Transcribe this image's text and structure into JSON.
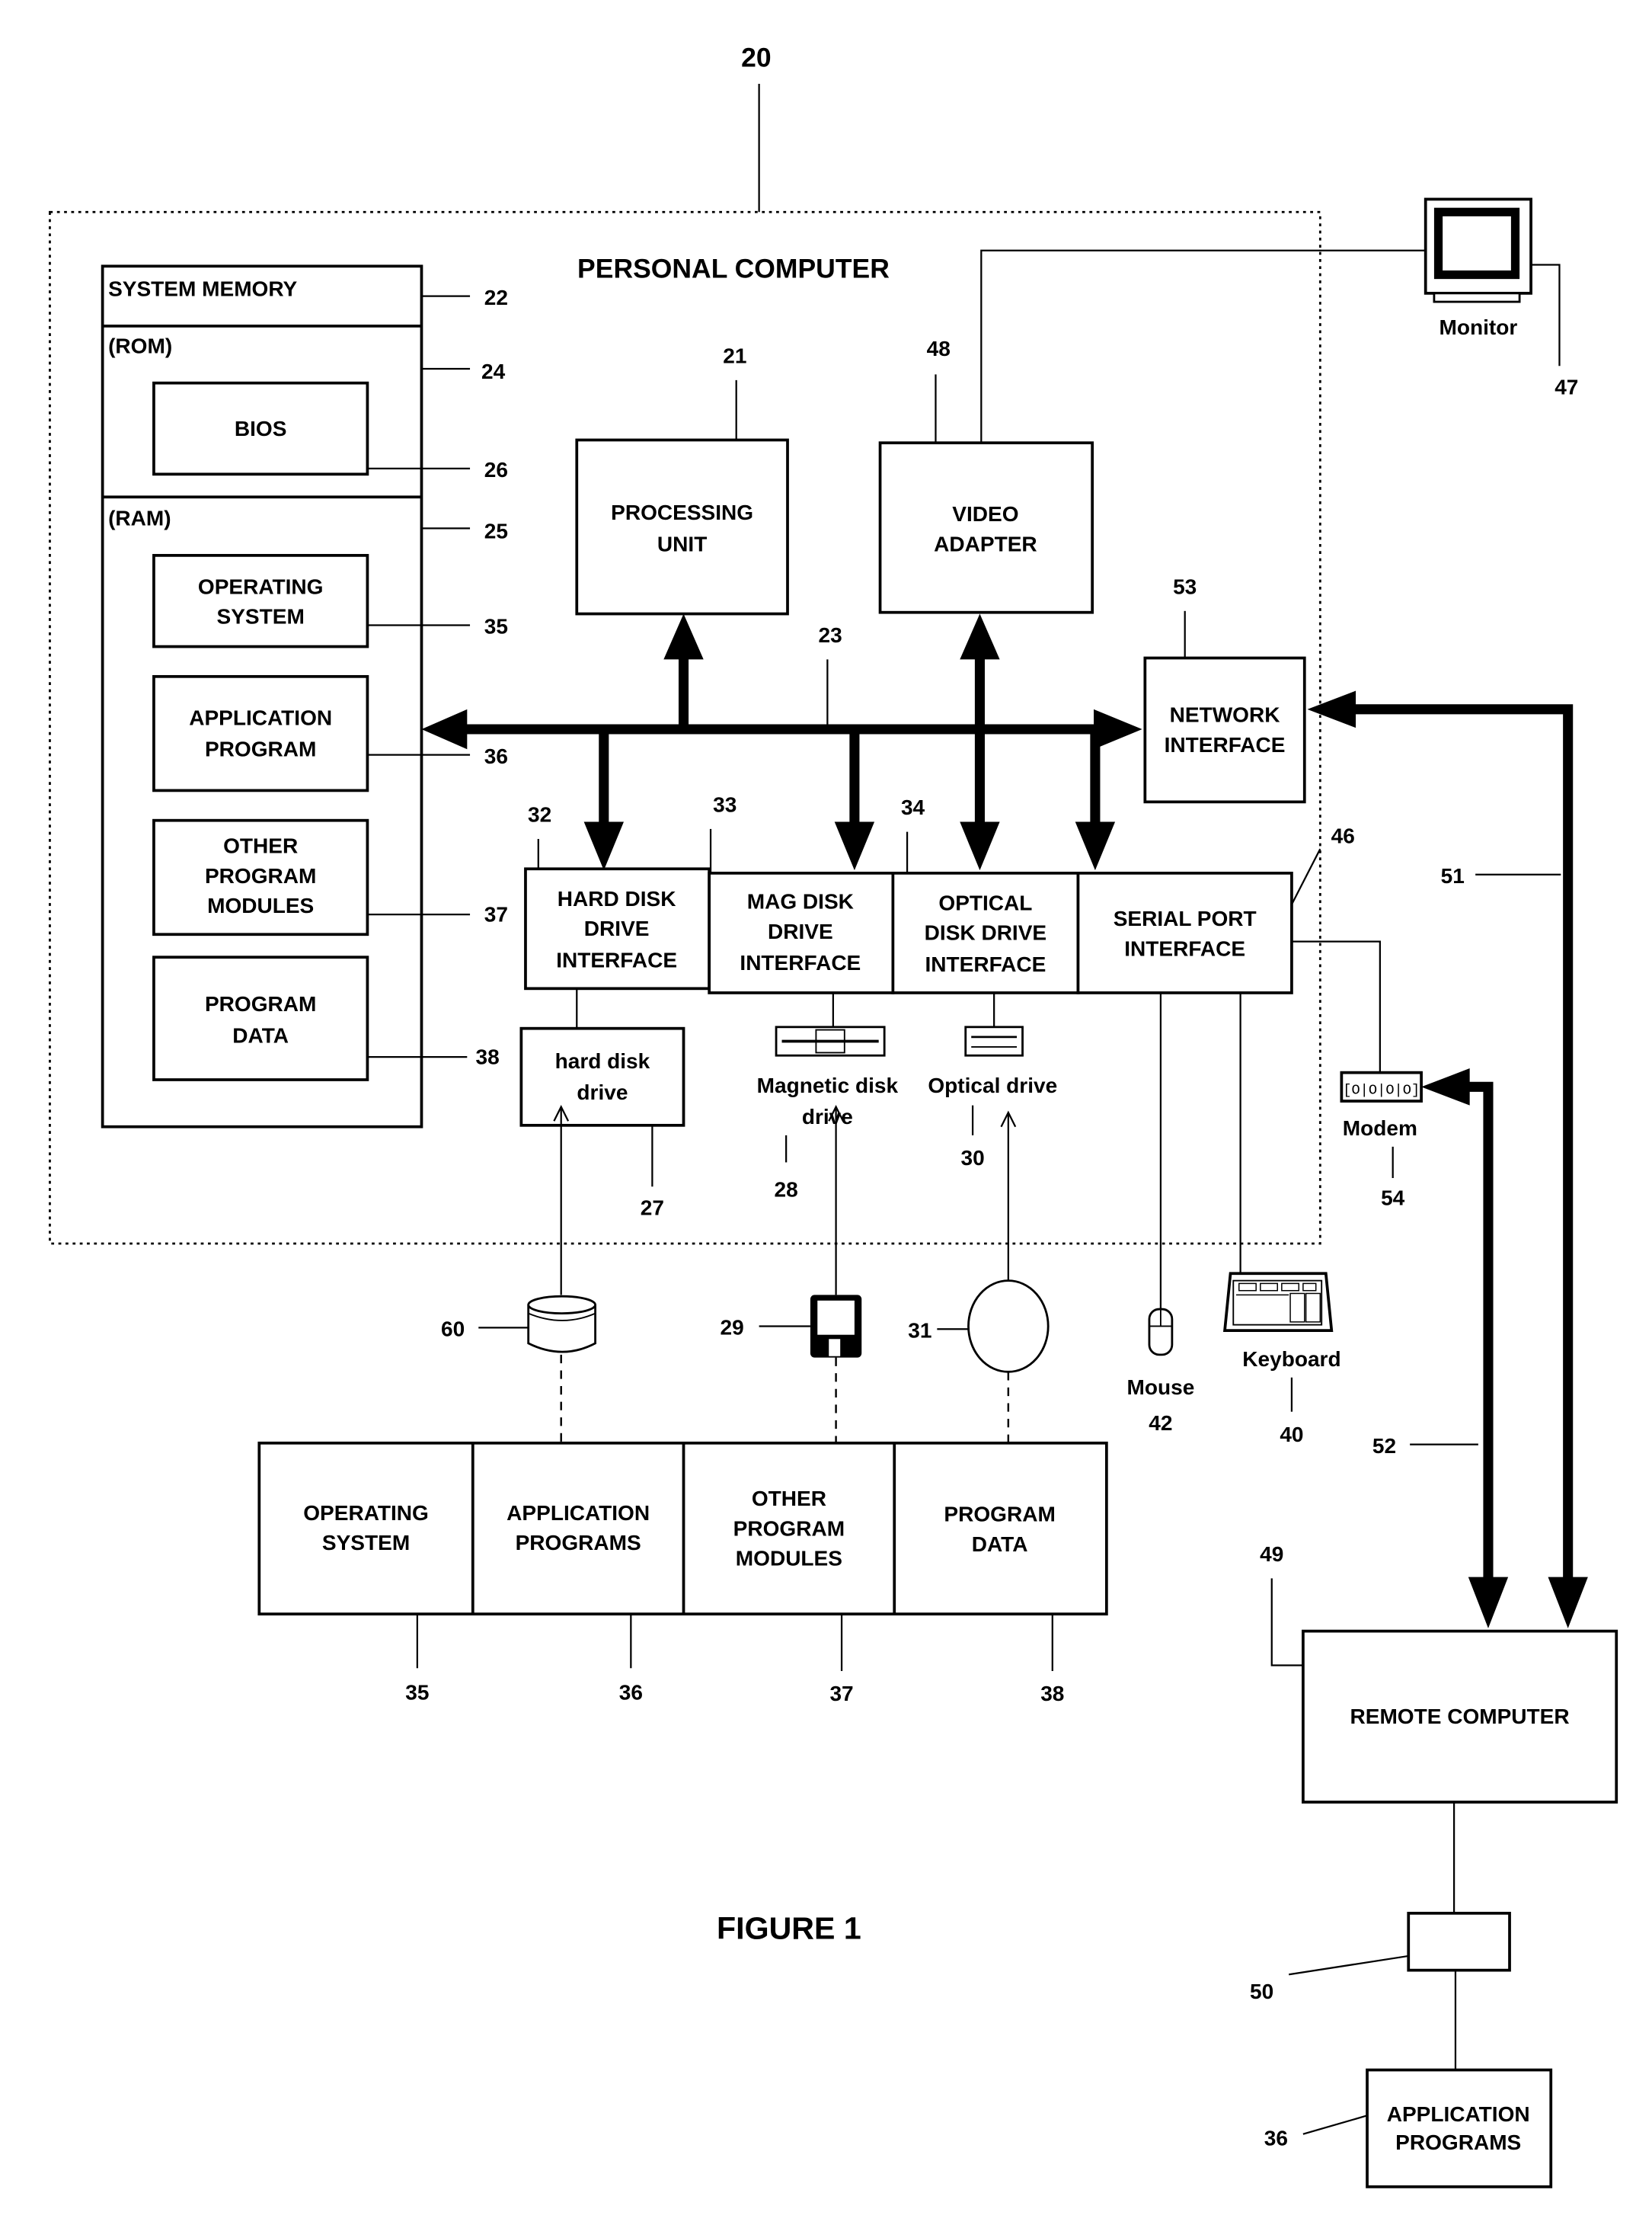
{
  "figure": {
    "caption": "FIGURE 1",
    "ref_pc": "20",
    "title": "PERSONAL COMPUTER"
  },
  "system_memory": {
    "title": "SYSTEM MEMORY",
    "ref": "22",
    "rom": {
      "label": "(ROM)",
      "ref": "24"
    },
    "bios": {
      "label": "BIOS",
      "ref": "26"
    },
    "ram": {
      "label": "(RAM)",
      "ref": "25"
    },
    "os": {
      "line1": "OPERATING",
      "line2": "SYSTEM",
      "ref": "35"
    },
    "app": {
      "line1": "APPLICATION",
      "line2": "PROGRAM",
      "ref": "36"
    },
    "modules": {
      "line1": "OTHER",
      "line2": "PROGRAM",
      "line3": "MODULES",
      "ref": "37"
    },
    "data": {
      "line1": "PROGRAM",
      "line2": "DATA",
      "ref": "38"
    }
  },
  "processing_unit": {
    "line1": "PROCESSING",
    "line2": "UNIT",
    "ref": "21"
  },
  "video_adapter": {
    "line1": "VIDEO",
    "line2": "ADAPTER",
    "ref": "48"
  },
  "system_bus": {
    "ref": "23"
  },
  "network_interface": {
    "line1": "NETWORK",
    "line2": "INTERFACE",
    "ref": "53"
  },
  "monitor": {
    "label": "Monitor",
    "ref": "47"
  },
  "hdd_interface": {
    "line1": "HARD DISK",
    "line2": "DRIVE",
    "line3": "INTERFACE",
    "ref": "32"
  },
  "mag_interface": {
    "line1": "MAG DISK",
    "line2": "DRIVE",
    "line3": "INTERFACE",
    "ref": "33"
  },
  "optical_interface": {
    "line1": "OPTICAL",
    "line2": "DISK DRIVE",
    "line3": "INTERFACE",
    "ref": "34"
  },
  "serial_interface": {
    "line1": "SERIAL PORT",
    "line2": "INTERFACE",
    "ref": "46"
  },
  "hard_disk_drive": {
    "line1": "hard disk",
    "line2": "drive",
    "ref": "27"
  },
  "magnetic_drive": {
    "line1": "Magnetic disk",
    "line2": "drive",
    "ref": "28"
  },
  "optical_drive": {
    "label": "Optical drive",
    "ref": "30"
  },
  "modem": {
    "label": "Modem",
    "ref": "54"
  },
  "wan_link": {
    "ref": "52"
  },
  "lan_link": {
    "ref": "51"
  },
  "hard_disk_media": {
    "ref": "60"
  },
  "floppy_disk": {
    "ref": "29"
  },
  "optical_disk": {
    "ref": "31"
  },
  "mouse": {
    "label": "Mouse",
    "ref": "42"
  },
  "keyboard": {
    "label": "Keyboard",
    "ref": "40"
  },
  "storage_contents": {
    "os": {
      "line1": "OPERATING",
      "line2": "SYSTEM",
      "ref": "35"
    },
    "apps": {
      "line1": "APPLICATION",
      "line2": "PROGRAMS",
      "ref": "36"
    },
    "modules": {
      "line1": "OTHER",
      "line2": "PROGRAM",
      "line3": "MODULES",
      "ref": "37"
    },
    "data": {
      "line1": "PROGRAM",
      "line2": "DATA",
      "ref": "38"
    }
  },
  "remote_computer": {
    "label": "REMOTE COMPUTER",
    "ref": "49"
  },
  "remote_storage": {
    "ref": "50"
  },
  "remote_apps": {
    "line1": "APPLICATION",
    "line2": "PROGRAMS",
    "ref": "36"
  }
}
